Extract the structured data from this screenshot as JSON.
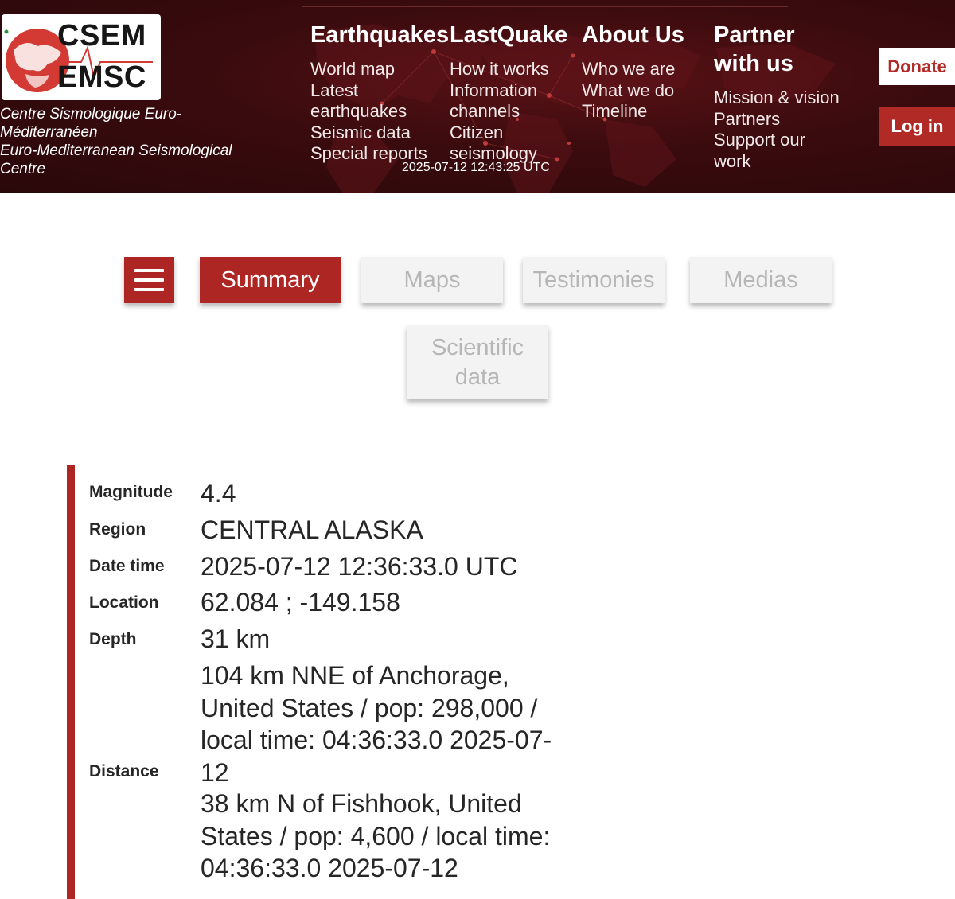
{
  "header": {
    "logo": {
      "line1": "CSEM",
      "line2": "EMSC"
    },
    "org_name_fr": "Centre Sismologique Euro-Méditerranéen",
    "org_name_en": "Euro-Mediterranean Seismological Centre",
    "timestamp": "2025-07-12 12:43:25 UTC",
    "donate_label": "Donate",
    "login_label": "Log in",
    "nav": [
      {
        "heading": "Earthquakes",
        "links": [
          "World map",
          "Latest earthquakes",
          "Seismic data",
          "Special reports"
        ]
      },
      {
        "heading": "LastQuake",
        "links": [
          "How it works",
          "Information channels",
          "Citizen seismology"
        ]
      },
      {
        "heading": "About Us",
        "links": [
          "Who we are",
          "What we do",
          "Timeline"
        ]
      },
      {
        "heading": "Partner with us",
        "links": [
          "Mission & vision",
          "Partners",
          "Support our work"
        ]
      }
    ]
  },
  "tabs": {
    "summary": "Summary",
    "maps": "Maps",
    "testimonies": "Testimonies",
    "medias": "Medias",
    "scientific": "Scientific data"
  },
  "details": {
    "magnitude_label": "Magnitude",
    "magnitude": "4.4",
    "region_label": "Region",
    "region": "CENTRAL ALASKA",
    "datetime_label": "Date time",
    "datetime": "2025-07-12 12:36:33.0 UTC",
    "location_label": "Location",
    "location": "62.084 ; -149.158",
    "depth_label": "Depth",
    "depth": "31 km",
    "distance_label": "Distance",
    "distance_1": "104 km NNE of Anchorage, United States / pop: 298,000 / local time: 04:36:33.0 2025-07-12",
    "distance_2": "38 km N of Fishhook, United States / pop: 4,600 / local time: 04:36:33.0 2025-07-12"
  },
  "colors": {
    "header_bg": "#3a0b0e",
    "accent_red": "#ae2624",
    "tab_inactive_bg": "#f3f3f3",
    "tab_inactive_text": "#b6b6b6"
  }
}
